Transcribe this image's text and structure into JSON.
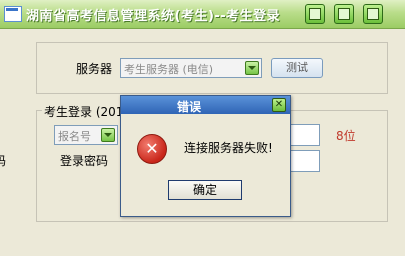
{
  "window": {
    "title": "湖南省高考信息管理系统(考生)--考生登录"
  },
  "server": {
    "label": "服务器",
    "selected": "考生服务器 (电信)",
    "test_button": "测试"
  },
  "login": {
    "group_label": "考生登录 (2012",
    "id_type_selected": "报名号",
    "id_hint": "8位",
    "password_label": "登录密码",
    "left_edge_char": "码"
  },
  "dialog": {
    "title": "错误",
    "message": "连接服务器失败!",
    "ok_label": "确定"
  }
}
